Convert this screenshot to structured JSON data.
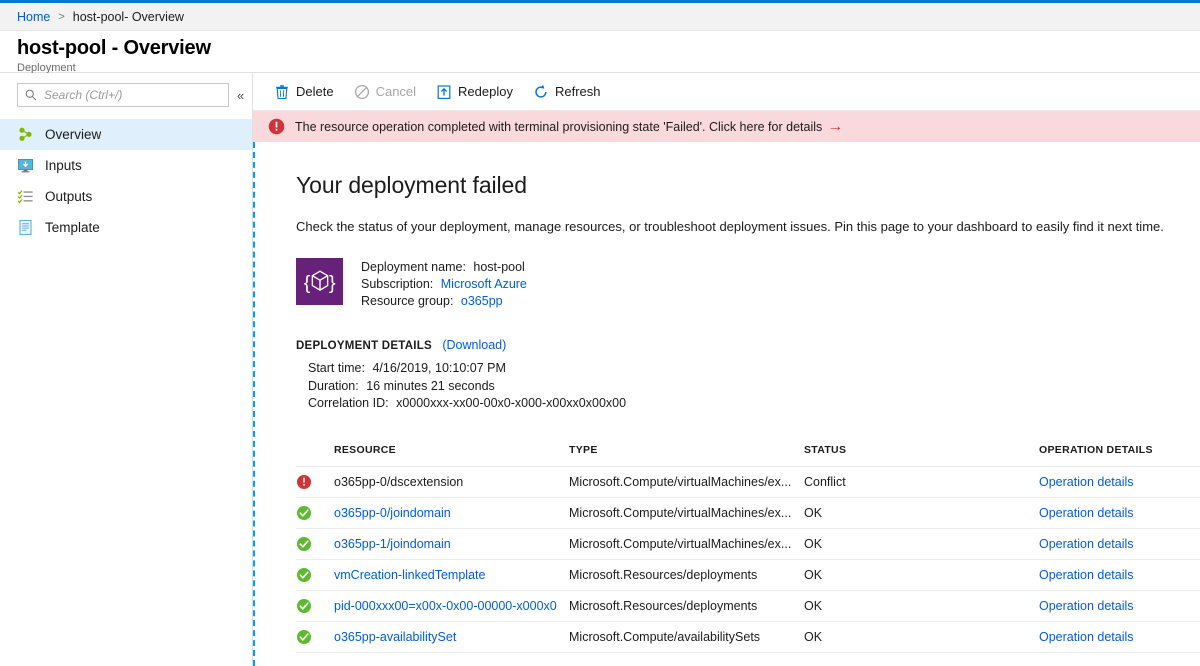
{
  "breadcrumb": {
    "home": "Home",
    "separator": ">",
    "current": "host-pool- Overview"
  },
  "header": {
    "title": "host-pool - Overview",
    "subtitle": "Deployment"
  },
  "sidebar": {
    "search_placeholder": "Search (Ctrl+/)",
    "search_value": "",
    "collapse_label": "«",
    "items": [
      {
        "label": "Overview",
        "icon": "overview-resource-icon",
        "selected": true
      },
      {
        "label": "Inputs",
        "icon": "inputs-monitor-icon",
        "selected": false
      },
      {
        "label": "Outputs",
        "icon": "outputs-list-icon",
        "selected": false
      },
      {
        "label": "Template",
        "icon": "template-document-icon",
        "selected": false
      }
    ]
  },
  "toolbar": {
    "delete_label": "Delete",
    "cancel_label": "Cancel",
    "redeploy_label": "Redeploy",
    "refresh_label": "Refresh"
  },
  "error_banner": {
    "text": "The resource operation completed with terminal provisioning state 'Failed'. Click here for details",
    "arrow": "→",
    "background": "#f9d9dc",
    "icon_color": "#d13438"
  },
  "main": {
    "heading": "Your deployment failed",
    "description": "Check the status of your deployment, manage resources, or troubleshoot deployment issues. Pin this page to your dashboard to easily find it next time.",
    "summary": {
      "deployment_name_label": "Deployment name:",
      "deployment_name_value": "host-pool",
      "subscription_label": "Subscription:",
      "subscription_value": "Microsoft Azure",
      "resource_group_label": "Resource group:",
      "resource_group_value": "o365pp",
      "icon_background": "#68217a"
    },
    "deployment_details": {
      "heading": "DEPLOYMENT DETAILS",
      "download_label": "(Download)",
      "start_time_label": "Start time:",
      "start_time_value": "4/16/2019, 10:10:07 PM",
      "duration_label": "Duration:",
      "duration_value": "16 minutes 21 seconds",
      "correlation_label": "Correlation ID:",
      "correlation_value": "x0000xxx-xx00-00x0-x000-x00xx0x00x00"
    },
    "table": {
      "columns": [
        "RESOURCE",
        "TYPE",
        "STATUS",
        "OPERATION DETAILS"
      ],
      "rows": [
        {
          "status_icon": "error-icon",
          "resource": "o365pp-0/dscextension",
          "resource_is_link": false,
          "type": "Microsoft.Compute/virtualMachines/ex...",
          "status": "Conflict",
          "operation": "Operation details"
        },
        {
          "status_icon": "success-icon",
          "resource": "o365pp-0/joindomain",
          "resource_is_link": true,
          "type": "Microsoft.Compute/virtualMachines/ex...",
          "status": "OK",
          "operation": "Operation details"
        },
        {
          "status_icon": "success-icon",
          "resource": "o365pp-1/joindomain",
          "resource_is_link": true,
          "type": "Microsoft.Compute/virtualMachines/ex...",
          "status": "OK",
          "operation": "Operation details"
        },
        {
          "status_icon": "success-icon",
          "resource": "vmCreation-linkedTemplate",
          "resource_is_link": true,
          "type": "Microsoft.Resources/deployments",
          "status": "OK",
          "operation": "Operation details"
        },
        {
          "status_icon": "success-icon",
          "resource": "pid-000xxx00=x00x-0x00-00000-x000x0",
          "resource_is_link": true,
          "type": "Microsoft.Resources/deployments",
          "status": "OK",
          "operation": "Operation details"
        },
        {
          "status_icon": "success-icon",
          "resource": "o365pp-availabilitySet",
          "resource_is_link": true,
          "type": "Microsoft.Compute/availabilitySets",
          "status": "OK",
          "operation": "Operation details"
        }
      ]
    }
  },
  "colors": {
    "accent": "#0078d4",
    "link": "#015cda",
    "error": "#d13438",
    "success": "#5dba2e",
    "selected_nav": "#dfeffc"
  }
}
